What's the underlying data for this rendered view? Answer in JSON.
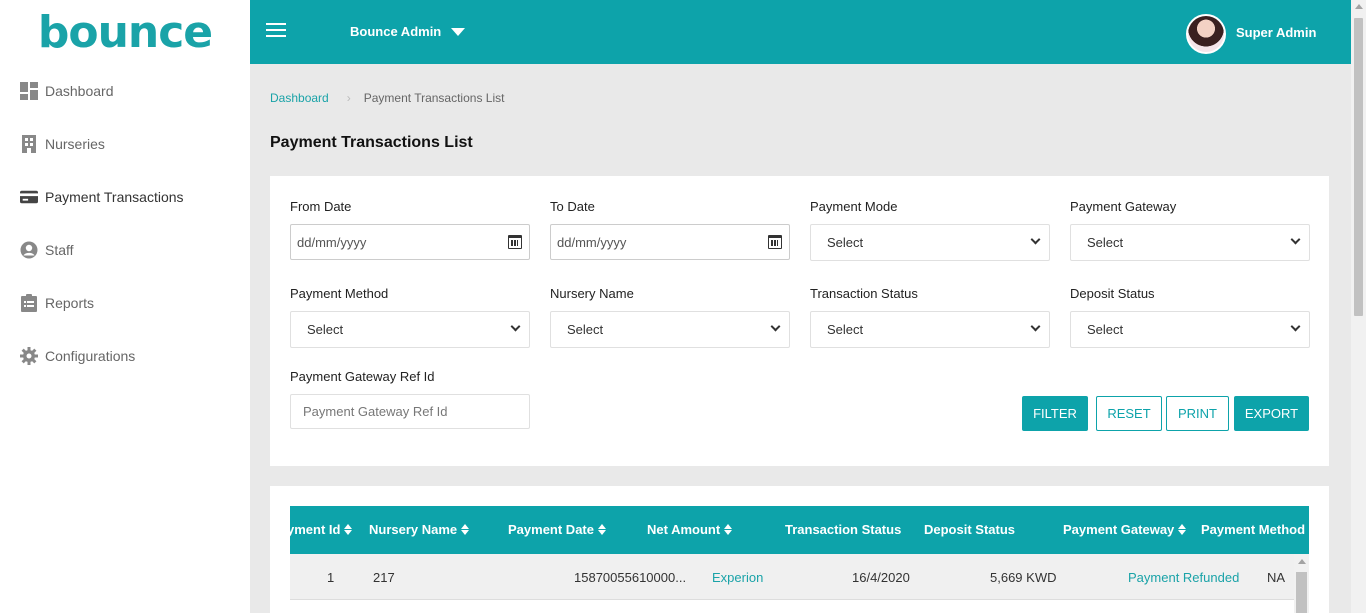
{
  "app": {
    "logo_text": "bounce"
  },
  "sidebar": {
    "items": [
      {
        "label": "Dashboard",
        "icon": "dashboard-icon"
      },
      {
        "label": "Nurseries",
        "icon": "building-icon"
      },
      {
        "label": "Payment Transactions",
        "icon": "credit-card-icon"
      },
      {
        "label": "Staff",
        "icon": "user-circle-icon"
      },
      {
        "label": "Reports",
        "icon": "clipboard-icon"
      },
      {
        "label": "Configurations",
        "icon": "gear-icon"
      }
    ]
  },
  "header": {
    "admin_select": "Bounce Admin",
    "user_name": "Super Admin"
  },
  "breadcrumb": {
    "home": "Dashboard",
    "current": "Payment Transactions List"
  },
  "page": {
    "title": "Payment Transactions List"
  },
  "filters": {
    "from_date": {
      "label": "From Date",
      "placeholder": "dd/mm/yyyy"
    },
    "to_date": {
      "label": "To Date",
      "placeholder": "dd/mm/yyyy"
    },
    "payment_mode": {
      "label": "Payment Mode",
      "value": "Select"
    },
    "payment_gateway": {
      "label": "Payment Gateway",
      "value": "Select"
    },
    "payment_method": {
      "label": "Payment Method",
      "value": "Select"
    },
    "nursery_name": {
      "label": "Nursery Name",
      "value": "Select"
    },
    "transaction_status": {
      "label": "Transaction Status",
      "value": "Select"
    },
    "deposit_status": {
      "label": "Deposit Status",
      "value": "Select"
    },
    "gateway_ref": {
      "label": "Payment Gateway Ref Id",
      "placeholder": "Payment Gateway Ref Id"
    }
  },
  "buttons": {
    "filter": "FILTER",
    "reset": "RESET",
    "print": "PRINT",
    "export": "EXPORT"
  },
  "table": {
    "headers": [
      "yment Id",
      "Nursery Name",
      "Payment Date",
      "Net Amount",
      "Transaction Status",
      "Deposit Status",
      "Payment Gateway",
      "Payment Method"
    ],
    "rows": [
      [
        "1",
        "217",
        "15870055610000...",
        "Experion",
        "16/4/2020",
        "5,669 KWD",
        "Payment Refunded",
        "NA"
      ]
    ]
  },
  "colors": {
    "accent": "#0da3aa",
    "link": "#1aa3a8"
  }
}
